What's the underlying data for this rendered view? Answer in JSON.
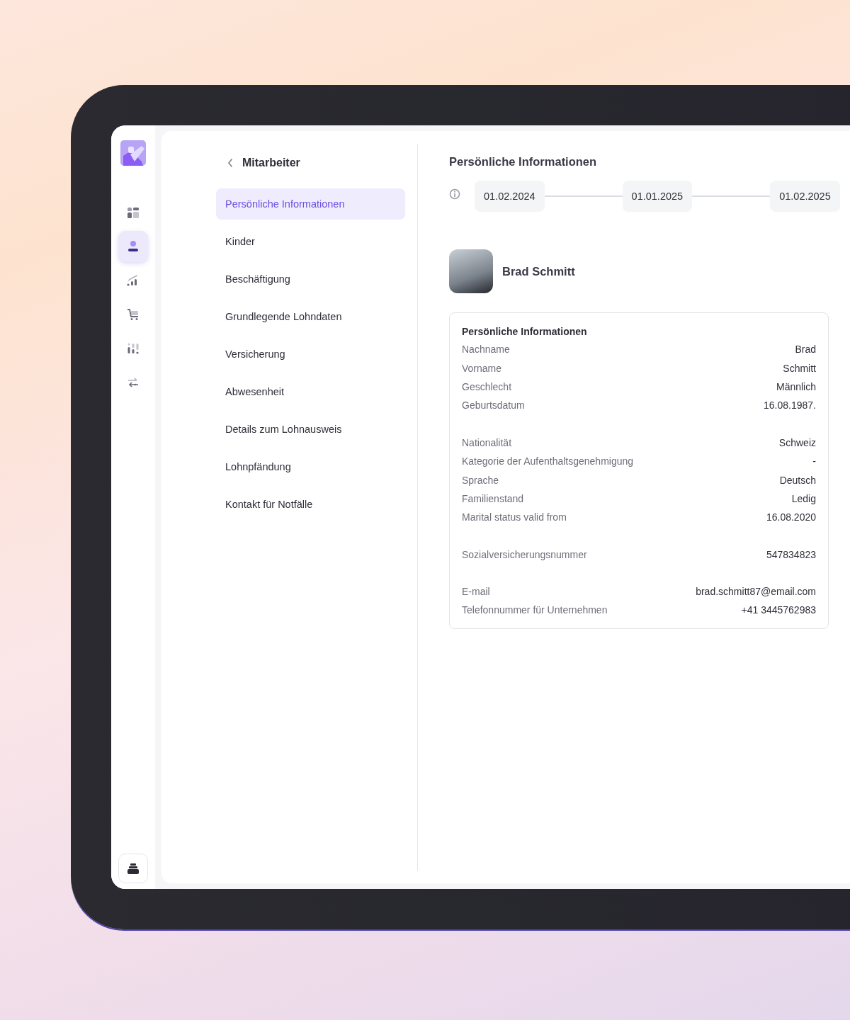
{
  "rail": {
    "items": [
      {
        "kind": "dashboard",
        "selected": false
      },
      {
        "kind": "person",
        "selected": true
      },
      {
        "kind": "chart",
        "selected": false
      },
      {
        "kind": "cart",
        "selected": false
      },
      {
        "kind": "bars",
        "selected": false
      },
      {
        "kind": "transfer",
        "selected": false
      }
    ]
  },
  "nav": {
    "back_title": "Mitarbeiter",
    "items": [
      {
        "label": "Persönliche Informationen",
        "selected": true
      },
      {
        "label": "Kinder",
        "selected": false
      },
      {
        "label": "Beschäftigung",
        "selected": false
      },
      {
        "label": "Grundlegende Lohndaten",
        "selected": false
      },
      {
        "label": "Versicherung",
        "selected": false
      },
      {
        "label": "Abwesenheit",
        "selected": false
      },
      {
        "label": "Details zum Lohnausweis",
        "selected": false
      },
      {
        "label": "Lohnpfändung",
        "selected": false
      },
      {
        "label": "Kontakt für Notfälle",
        "selected": false
      }
    ]
  },
  "content": {
    "title": "Persönliche Informationen",
    "timeline": [
      "01.02.2024",
      "01.01.2025",
      "01.02.2025"
    ],
    "employee_name": "Brad Schmitt",
    "card": {
      "title": "Persönliche Informationen",
      "groups": [
        [
          {
            "label": "Nachname",
            "value": "Brad"
          },
          {
            "label": "Vorname",
            "value": "Schmitt"
          },
          {
            "label": "Geschlecht",
            "value": "Männlich"
          },
          {
            "label": "Geburtsdatum",
            "value": "16.08.1987."
          }
        ],
        [
          {
            "label": "Nationalität",
            "value": "Schweiz"
          },
          {
            "label": "Kategorie der Aufenthaltsgenehmigung",
            "value": "-"
          },
          {
            "label": "Sprache",
            "value": "Deutsch"
          },
          {
            "label": "Familienstand",
            "value": "Ledig"
          },
          {
            "label": "Marital status valid from",
            "value": "16.08.2020"
          }
        ],
        [
          {
            "label": "Sozialversicherungsnummer",
            "value": "547834823"
          }
        ],
        [
          {
            "label": "E-mail",
            "value": "brad.schmitt87@email.com"
          },
          {
            "label": "Telefonnummer für Unternehmen",
            "value": "+41 3445762983"
          }
        ]
      ]
    }
  }
}
